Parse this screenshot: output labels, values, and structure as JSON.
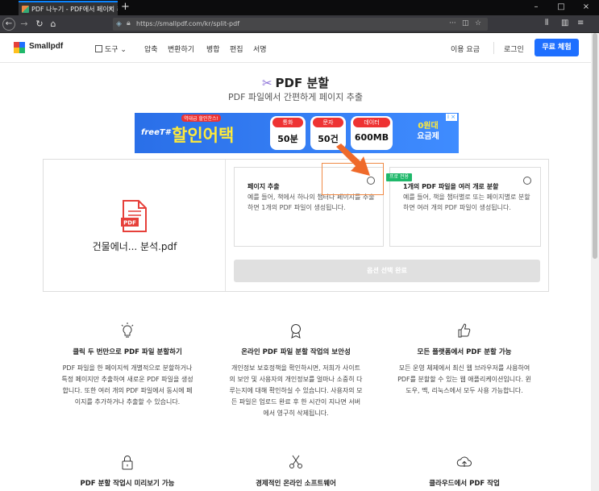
{
  "browser": {
    "tab_title": "PDF 나누기 - PDF에서 페이지 추출",
    "tab_close": "×",
    "new_tab": "+",
    "url": "https://smallpdf.com/kr/split-pdf",
    "back_icon": "arrow-left",
    "forward_icon": "arrow-right",
    "reload_icon": "reload",
    "home_icon": "home",
    "url_more": "···",
    "window_controls": [
      "–",
      "□",
      "×"
    ]
  },
  "header": {
    "brand": "Smallpdf",
    "tools_label": "도구 ⌄",
    "nav": [
      "압축",
      "변환하기",
      "병합",
      "편집",
      "서명"
    ],
    "pricing": "이용 요금",
    "login": "로그인",
    "trial": "무료 체험",
    "logo_colors": [
      "#e6403a",
      "#1e6fff",
      "#ffc01e",
      "#1fb86a"
    ]
  },
  "page": {
    "title": "PDF 분할",
    "subtitle": "PDF 파일에서 간편하게 페이지 추출"
  },
  "ad": {
    "brand": "freeT#",
    "headline": "할인어택",
    "tag": "역대급 할인찬스!",
    "pills": [
      {
        "label": "통화",
        "value": "50분"
      },
      {
        "label": "문자",
        "value": "50건"
      },
      {
        "label": "데이터",
        "value": "600MB"
      }
    ],
    "right_top": "0원대",
    "right_bottom": "요금제",
    "adinfo": "i ×"
  },
  "card": {
    "file_name": "건물에너... 분석.pdf",
    "pdf_badge": "PDF",
    "options": [
      {
        "title": "페이지 추출",
        "desc": "예를 들어, 책에서 하나의 챕터나 페이지를 추출하면 1개의 PDF 파일이 생성됩니다."
      },
      {
        "title": "1개의 PDF 파일을 여러 개로 분할",
        "desc": "예를 들어, 책을 챕터별로 또는 페이지별로 분할하면 여러 개의 PDF 파일이 생성됩니다."
      }
    ],
    "pro_badge": "프로 전용",
    "apply_button": "옵션 선택 완료"
  },
  "features": [
    {
      "icon": "lightbulb-icon",
      "title": "클릭 두 번만으로 PDF 파일 분할하기",
      "desc": "PDF 파일을 한 페이지씩 개별적으로 분할하거나 특정 페이지만 추출하여 새로운 PDF 파일을 생성합니다. 또한 여러 개의 PDF 파일에서 동시에 페이지를 추가하거나 추출할 수 있습니다."
    },
    {
      "icon": "award-icon",
      "title": "온라인 PDF 파일 분할 작업의 보안성",
      "desc": "개인정보 보호정책을 확인하시면, 저희가 사이트의 보안 및 사용자의 개인정보를 얼마나 소중히 다루는지에 대해 확인하실 수 있습니다. 사용자의 모든 파일은 업로드 완료 후 한 시간이 지나면 서버에서 영구히 삭제됩니다."
    },
    {
      "icon": "thumbs-up-icon",
      "title": "모든 플랫폼에서 PDF 분할 가능",
      "desc": "모든 운영 체제에서 최신 웹 브라우저를 사용하여 PDF를 분할할 수 있는 웹 애플리케이션입니다. 윈도우, 맥, 리눅스에서 모두 사용 가능합니다."
    }
  ],
  "features2": [
    {
      "icon": "lock-icon",
      "title": "PDF 분할 작업시 미리보기 가능"
    },
    {
      "icon": "scissors-icon",
      "title": "경제적인 온라인 소프트웨어"
    },
    {
      "icon": "cloud-upload-icon",
      "title": "클라우드에서 PDF 작업"
    }
  ]
}
